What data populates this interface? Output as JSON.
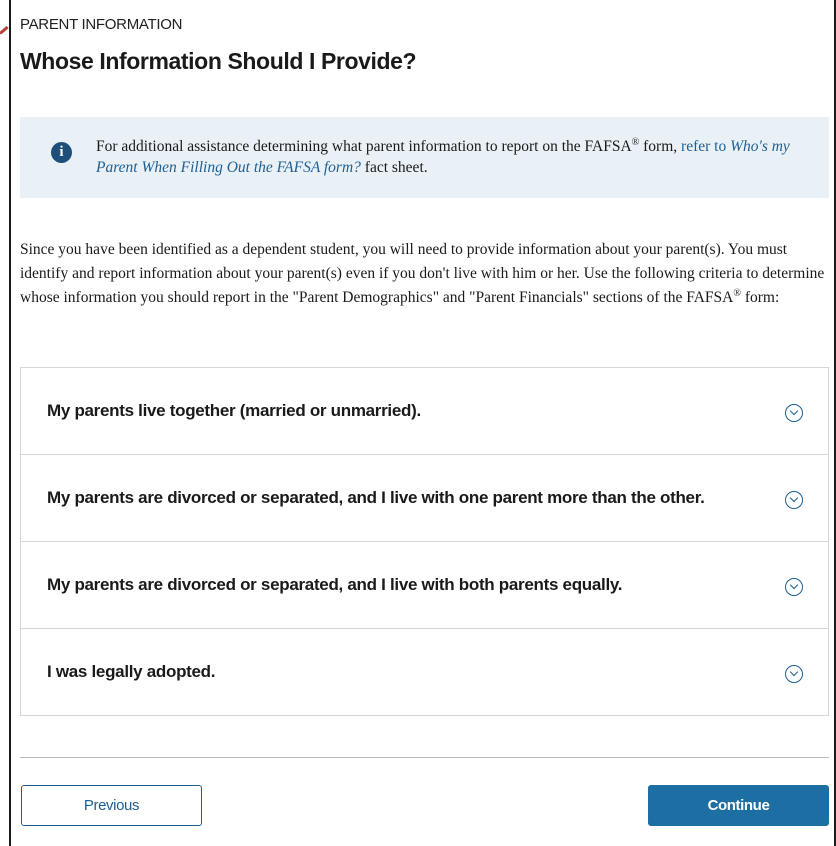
{
  "header": {
    "section_label": "PARENT INFORMATION",
    "title": "Whose Information Should I Provide?"
  },
  "info_box": {
    "icon": "info-icon",
    "icon_glyph": "i",
    "text_before": "For additional assistance determining what parent information to report on the FAFSA",
    "registered_mark": "®",
    "text_form": " form, ",
    "link_prefix": "refer to ",
    "link_italic": "Who's my Parent When Filling Out the FAFSA form?",
    "text_after": " fact sheet."
  },
  "body": {
    "paragraph": "Since you have been identified as a dependent student, you will need to provide information about your parent(s). You must identify and report information about your parent(s) even if you don't live with him or her. Use the following criteria to determine whose information you should report in the \"Parent Demographics\" and \"Parent Financials\" sections of the FAFSA",
    "registered_mark": "®",
    "paragraph_end": " form:"
  },
  "accordion": {
    "items": [
      {
        "label": "My parents live together (married or unmarried).",
        "icon": "chevron-down-circle-icon"
      },
      {
        "label": "My parents are divorced or separated, and I live with one parent more than the other.",
        "icon": "chevron-down-circle-icon"
      },
      {
        "label": "My parents are divorced or separated, and I live with both parents equally.",
        "icon": "chevron-down-circle-icon"
      },
      {
        "label": "I was legally adopted.",
        "icon": "chevron-down-circle-icon"
      }
    ]
  },
  "footer": {
    "previous_label": "Previous",
    "continue_label": "Continue"
  },
  "colors": {
    "accent": "#1e5f93",
    "primary_button": "#1d6fa3",
    "info_background": "#e9f0f6",
    "info_icon": "#1d4f7a"
  }
}
